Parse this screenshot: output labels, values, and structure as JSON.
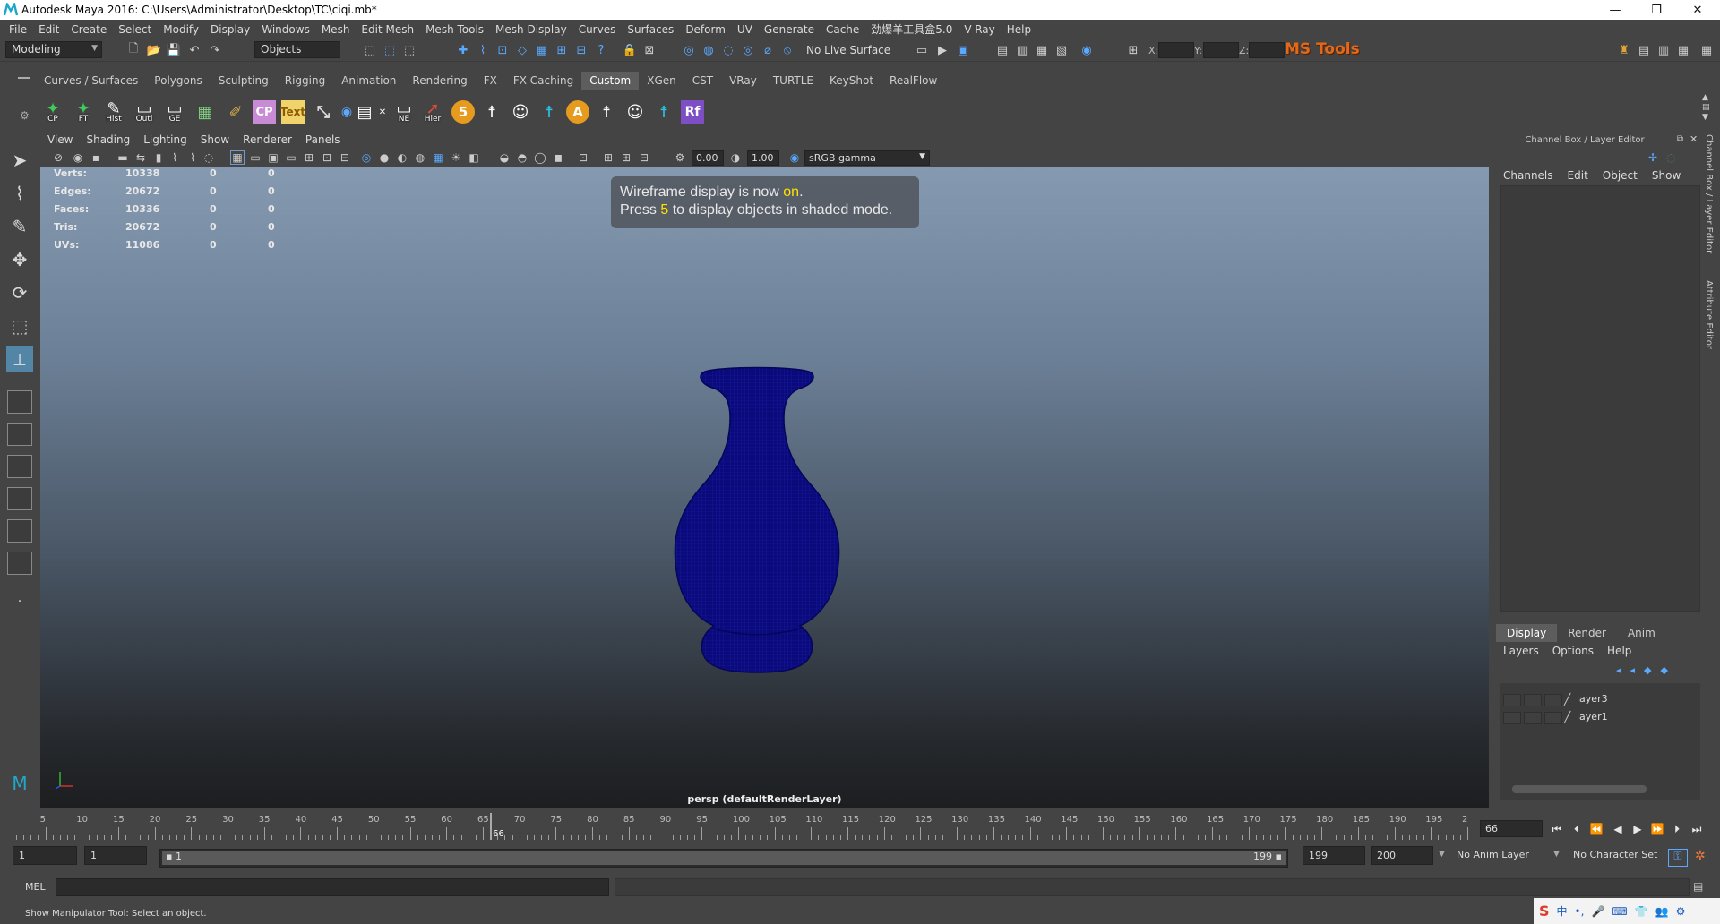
{
  "window": {
    "title": "Autodesk Maya 2016: C:\\Users\\Administrator\\Desktop\\TC\\ciqi.mb*",
    "controls": [
      "—",
      "❐",
      "✕"
    ]
  },
  "menubar": [
    "File",
    "Edit",
    "Create",
    "Select",
    "Modify",
    "Display",
    "Windows",
    "Mesh",
    "Edit Mesh",
    "Mesh Tools",
    "Mesh Display",
    "Curves",
    "Surfaces",
    "Deform",
    "UV",
    "Generate",
    "Cache",
    "劲爆羊工具盒5.0",
    "V-Ray",
    "Help"
  ],
  "status": {
    "menuset": "Modeling",
    "selection_mode": "Objects",
    "live_surface": "No Live Surface",
    "x_label": "X:",
    "y_label": "Y:",
    "z_label": "Z:",
    "brand": "MS Tools"
  },
  "shelf": {
    "tabs": [
      "Curves / Surfaces",
      "Polygons",
      "Sculpting",
      "Rigging",
      "Animation",
      "Rendering",
      "FX",
      "FX Caching",
      "Custom",
      "XGen",
      "CST",
      "VRay",
      "TURTLE",
      "KeyShot",
      "RealFlow"
    ],
    "active_tab": "Custom",
    "button_labels": [
      "CP",
      "FT",
      "Hist",
      "Outl",
      "GE",
      "",
      "",
      "CP",
      "Text",
      "",
      "",
      "",
      "",
      "NE",
      "Hier",
      "5",
      "",
      "",
      "",
      "A",
      "",
      "",
      "",
      "Rf"
    ]
  },
  "viewport": {
    "menu": [
      "View",
      "Shading",
      "Lighting",
      "Show",
      "Renderer",
      "Panels"
    ],
    "exposure": "0.00",
    "gamma": "1.00",
    "colorspace": "sRGB gamma",
    "hud": [
      {
        "label": "Verts:",
        "total": "10338",
        "sel": "0",
        "comp": "0"
      },
      {
        "label": "Edges:",
        "total": "20672",
        "sel": "0",
        "comp": "0"
      },
      {
        "label": "Faces:",
        "total": "10336",
        "sel": "0",
        "comp": "0"
      },
      {
        "label": "Tris:",
        "total": "20672",
        "sel": "0",
        "comp": "0"
      },
      {
        "label": "UVs:",
        "total": "11086",
        "sel": "0",
        "comp": "0"
      }
    ],
    "message": {
      "line1_pre": "Wireframe display is now ",
      "line1_hl": "on",
      "line1_post": ".",
      "line2_pre": "Press ",
      "line2_hl": "5",
      "line2_post": " to display objects in shaded mode."
    },
    "camera_label": "persp (defaultRenderLayer)",
    "mesh_color": "#0a0a7a"
  },
  "channelbox": {
    "title": "Channel Box / Layer Editor",
    "menu": [
      "Channels",
      "Edit",
      "Object",
      "Show"
    ],
    "display_tabs": [
      "Display",
      "Render",
      "Anim"
    ],
    "active_display_tab": "Display",
    "layer_menu": [
      "Layers",
      "Options",
      "Help"
    ],
    "layers": [
      "layer3",
      "layer1"
    ],
    "side_tabs": [
      "Channel Box / Layer Editor",
      "Attribute Editor"
    ]
  },
  "timeline": {
    "start": 1,
    "end": 200,
    "labels": [
      "5",
      "10",
      "15",
      "20",
      "25",
      "30",
      "35",
      "40",
      "45",
      "50",
      "55",
      "60",
      "65",
      "70",
      "75",
      "80",
      "85",
      "90",
      "95",
      "100",
      "105",
      "110",
      "115",
      "120",
      "125",
      "130",
      "135",
      "140",
      "145",
      "150",
      "155",
      "160",
      "165",
      "170",
      "175",
      "180",
      "185",
      "190",
      "195",
      "2"
    ],
    "current_frame": "66"
  },
  "range": {
    "start": "1",
    "anim_start": "1",
    "handle_start": "1",
    "handle_end": "199",
    "range_end": "199",
    "anim_end": "200",
    "anim_layer": "No Anim Layer",
    "character_set": "No Character Set"
  },
  "commandline": {
    "language": "MEL"
  },
  "helpline": {
    "text": "Show Manipulator Tool: Select an object."
  },
  "tray": [
    "S",
    "中",
    "•,",
    "🎤",
    "⌨",
    "👕",
    "👥",
    "⚙"
  ]
}
